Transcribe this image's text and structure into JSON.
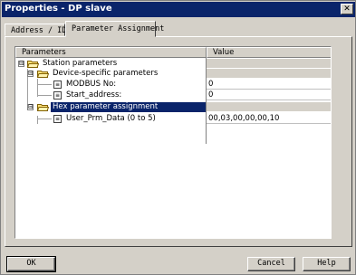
{
  "window": {
    "title": "Properties - DP slave",
    "close_label": "✕"
  },
  "tabs": [
    {
      "label": "Address / ID",
      "active": false
    },
    {
      "label": "Parameter Assignment",
      "active": true
    }
  ],
  "grid": {
    "columns": {
      "parameters": "Parameters",
      "value": "Value"
    },
    "rows": [
      {
        "label": "Station parameters",
        "value": "",
        "expander": "⊟"
      },
      {
        "label": "Device-specific parameters",
        "value": "",
        "expander": "⊟"
      },
      {
        "label": "MODBUS No:",
        "value": "0"
      },
      {
        "label": "Start_address:",
        "value": "0"
      },
      {
        "label": "Hex parameter assignment",
        "value": "",
        "expander": "⊟"
      },
      {
        "label": "User_Prm_Data (0 to 5)",
        "value": "00,03,00,00,00,10"
      }
    ]
  },
  "buttons": {
    "ok": "OK",
    "cancel": "Cancel",
    "help": "Help"
  },
  "colors": {
    "titlebar": "#0a246a",
    "selection": "#0a246a",
    "face": "#d4d0c8"
  }
}
